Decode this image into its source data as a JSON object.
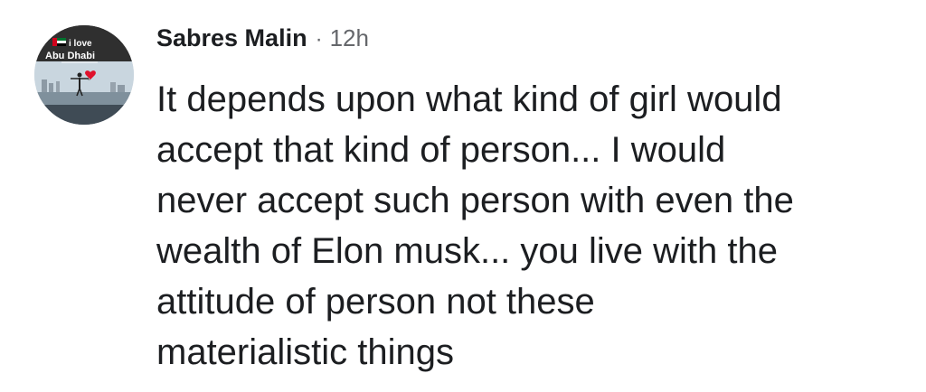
{
  "comment": {
    "avatar": {
      "badge_line1": "i love",
      "badge_line2": "Abu Dhabi"
    },
    "author": "Sabres Malin",
    "separator": "·",
    "timestamp": "12h",
    "lines": [
      "It depends upon what kind of girl would",
      "accept that kind of person... I would",
      "never accept such person with even the",
      "wealth of Elon musk... you live with the",
      "attitude of person not these",
      "materialistic things"
    ]
  }
}
